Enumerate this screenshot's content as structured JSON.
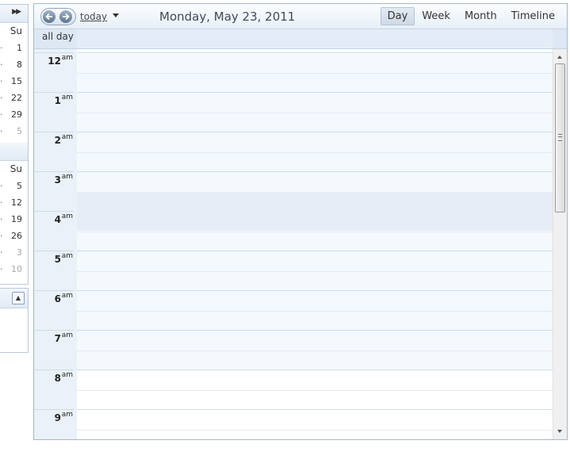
{
  "navigator": {
    "calendar_1": {
      "dow": "Su",
      "days": [
        {
          "label": "1",
          "other": false
        },
        {
          "label": "8",
          "other": false
        },
        {
          "label": "15",
          "other": false
        },
        {
          "label": "22",
          "other": false
        },
        {
          "label": "29",
          "other": false
        },
        {
          "label": "5",
          "other": true
        }
      ]
    },
    "calendar_2": {
      "dow": "Su",
      "days": [
        {
          "label": "5",
          "other": false
        },
        {
          "label": "12",
          "other": false
        },
        {
          "label": "19",
          "other": false
        },
        {
          "label": "26",
          "other": false
        },
        {
          "label": "3",
          "other": true
        },
        {
          "label": "10",
          "other": true
        }
      ]
    }
  },
  "toolbar": {
    "today_label": "today",
    "date_title": "Monday, May 23, 2011",
    "views": [
      {
        "label": "Day",
        "active": true
      },
      {
        "label": "Week",
        "active": false
      },
      {
        "label": "Month",
        "active": false
      },
      {
        "label": "Timeline",
        "active": false
      }
    ]
  },
  "allday": {
    "label": "all day"
  },
  "hours": [
    {
      "hour": "12",
      "ampm": "am",
      "work": false
    },
    {
      "hour": "1",
      "ampm": "am",
      "work": false
    },
    {
      "hour": "2",
      "ampm": "am",
      "work": false
    },
    {
      "hour": "3",
      "ampm": "am",
      "work": false
    },
    {
      "hour": "4",
      "ampm": "am",
      "work": false
    },
    {
      "hour": "5",
      "ampm": "am",
      "work": false
    },
    {
      "hour": "6",
      "ampm": "am",
      "work": false
    },
    {
      "hour": "7",
      "ampm": "am",
      "work": false
    },
    {
      "hour": "8",
      "ampm": "am",
      "work": true
    },
    {
      "hour": "9",
      "ampm": "am",
      "work": true
    }
  ],
  "selected_slot": {
    "start": "3:30 am",
    "end": "4:30 am"
  },
  "colors": {
    "nonwork_hours": "#f3f9fd",
    "work_hours": "#ffffff",
    "selection": "#e6edf6",
    "time_column": "#eaf1f8"
  }
}
